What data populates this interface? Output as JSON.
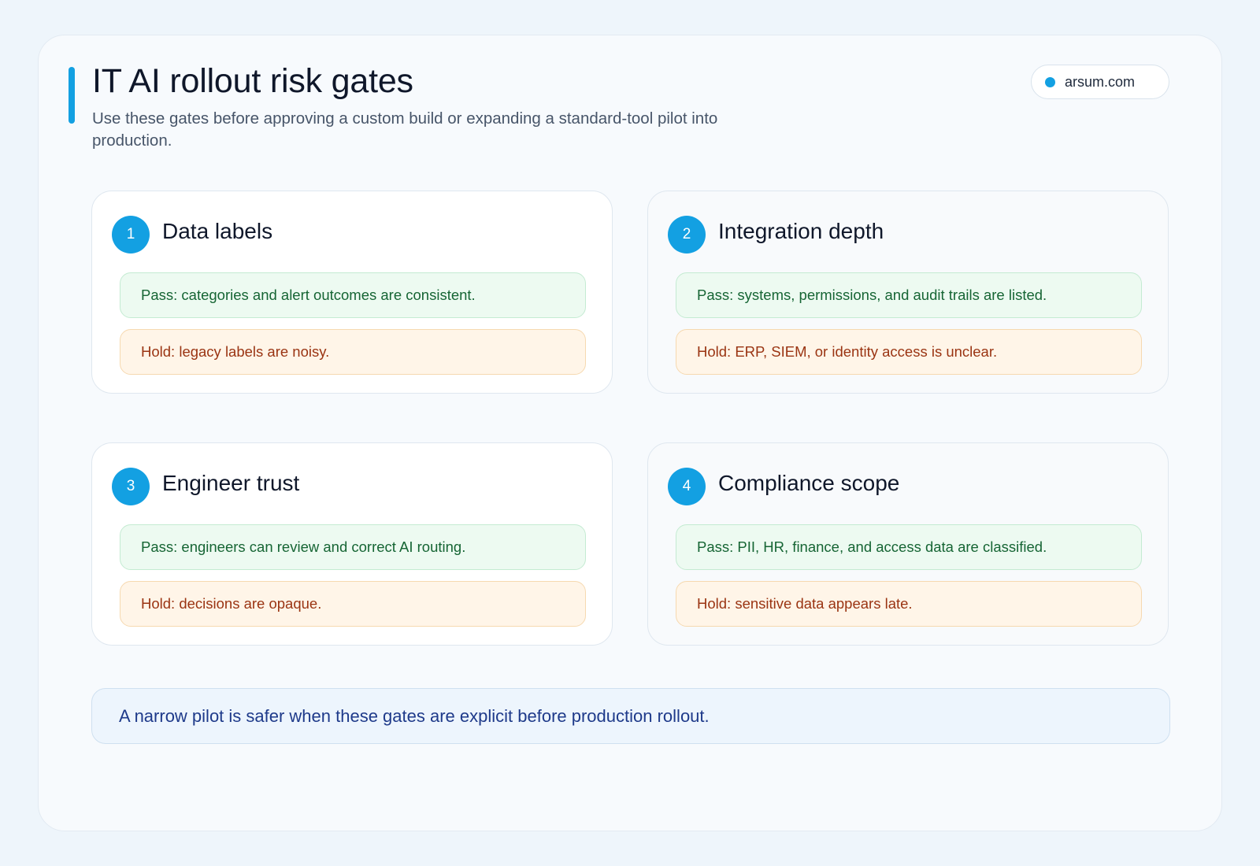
{
  "header": {
    "title": "IT AI rollout risk gates",
    "subtitle": "Use these gates before approving a custom build or expanding a standard-tool pilot into production.",
    "site_label": "arsum.com"
  },
  "gates": [
    {
      "number": "1",
      "title": "Data labels",
      "pass": "Pass: categories and alert outcomes are consistent.",
      "hold": "Hold: legacy labels are noisy."
    },
    {
      "number": "2",
      "title": "Integration depth",
      "pass": "Pass: systems, permissions, and audit trails are listed.",
      "hold": "Hold: ERP, SIEM, or identity access is unclear."
    },
    {
      "number": "3",
      "title": "Engineer trust",
      "pass": "Pass: engineers can review and correct AI routing.",
      "hold": "Hold: decisions are opaque."
    },
    {
      "number": "4",
      "title": "Compliance scope",
      "pass": "Pass: PII, HR, finance, and access data are classified.",
      "hold": "Hold: sensitive data appears late."
    }
  ],
  "footer_note": "A narrow pilot is safer when these gates are explicit before production rollout.",
  "colors": {
    "accent": "#13a0e2",
    "pass_text": "#166534",
    "hold_text": "#9a3412",
    "note_text": "#1e3a8a"
  }
}
